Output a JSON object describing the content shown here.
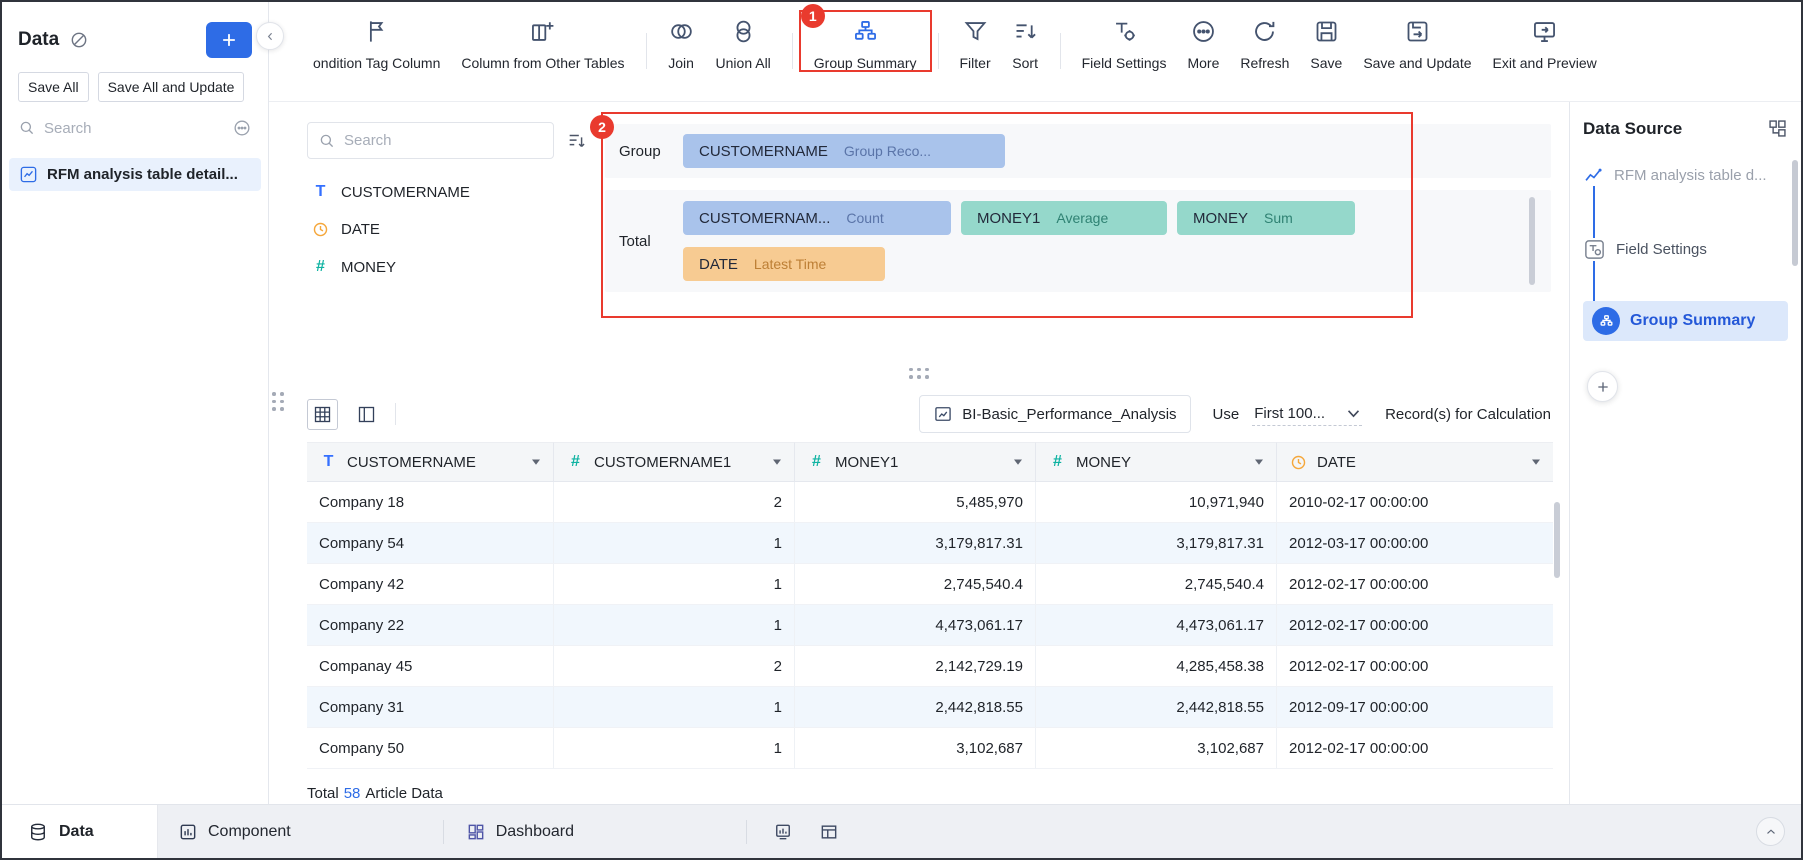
{
  "annotations": {
    "badge1": "1",
    "badge2": "2"
  },
  "left_sidebar": {
    "title": "Data",
    "save_all": "Save All",
    "save_all_update": "Save All and Update",
    "search_placeholder": "Search",
    "selected_table": "RFM analysis table detail..."
  },
  "toolbar": {
    "items": [
      {
        "label": "ondition Tag Column"
      },
      {
        "label": "Column from Other Tables"
      },
      {
        "label": "Join"
      },
      {
        "label": "Union All"
      },
      {
        "label": "Group Summary"
      },
      {
        "label": "Filter"
      },
      {
        "label": "Sort"
      },
      {
        "label": "Field Settings"
      },
      {
        "label": "More"
      },
      {
        "label": "Refresh"
      },
      {
        "label": "Save"
      },
      {
        "label": "Save and Update"
      },
      {
        "label": "Exit and Preview"
      }
    ]
  },
  "config": {
    "search_placeholder": "Search",
    "fields": [
      {
        "name": "CUSTOMERNAME",
        "icon": "text-icon"
      },
      {
        "name": "DATE",
        "icon": "date-icon"
      },
      {
        "name": "MONEY",
        "icon": "number-icon"
      }
    ],
    "group_label": "Group",
    "total_label": "Total",
    "group_chips": [
      {
        "name": "CUSTOMERNAME",
        "agg": "Group Reco...",
        "color": "blue"
      }
    ],
    "total_chips": [
      {
        "name": "CUSTOMERNAM...",
        "agg": "Count",
        "color": "blue"
      },
      {
        "name": "MONEY1",
        "agg": "Average",
        "color": "teal"
      },
      {
        "name": "MONEY",
        "agg": "Sum",
        "color": "teal"
      },
      {
        "name": "DATE",
        "agg": "Latest Time",
        "color": "orange"
      }
    ]
  },
  "table_bar": {
    "dataset": "BI-Basic_Performance_Analysis",
    "use": "Use",
    "records": "First 100...",
    "suffix": "Record(s) for Calculation"
  },
  "data_table": {
    "columns": [
      {
        "name": "CUSTOMERNAME",
        "icon": "text-icon"
      },
      {
        "name": "CUSTOMERNAME1",
        "icon": "number-icon"
      },
      {
        "name": "MONEY1",
        "icon": "number-icon"
      },
      {
        "name": "MONEY",
        "icon": "number-icon"
      },
      {
        "name": "DATE",
        "icon": "date-icon"
      }
    ],
    "rows": [
      [
        "Company 18",
        "2",
        "5,485,970",
        "10,971,940",
        "2010-02-17 00:00:00"
      ],
      [
        "Company 54",
        "1",
        "3,179,817.31",
        "3,179,817.31",
        "2012-03-17 00:00:00"
      ],
      [
        "Company 42",
        "1",
        "2,745,540.4",
        "2,745,540.4",
        "2012-02-17 00:00:00"
      ],
      [
        "Company 22",
        "1",
        "4,473,061.17",
        "4,473,061.17",
        "2012-02-17 00:00:00"
      ],
      [
        "Companay 45",
        "2",
        "2,142,729.19",
        "4,285,458.38",
        "2012-02-17 00:00:00"
      ],
      [
        "Company 31",
        "1",
        "2,442,818.55",
        "2,442,818.55",
        "2012-09-17 00:00:00"
      ],
      [
        "Company 50",
        "1",
        "3,102,687",
        "3,102,687",
        "2012-02-17 00:00:00"
      ]
    ],
    "footer": {
      "label": "Total",
      "count": "58",
      "suffix": "Article Data"
    }
  },
  "right_sidebar": {
    "title": "Data Source",
    "nodes": [
      {
        "label": "RFM analysis table d..."
      },
      {
        "label": "Field Settings"
      },
      {
        "label": "Group Summary"
      }
    ]
  },
  "bottom_bar": {
    "data": "Data",
    "component": "Component",
    "dashboard": "Dashboard"
  },
  "colors": {
    "primary_blue": "#2e6ce6",
    "annotation_red": "#e93a2e",
    "chip_blue": "#a9c3eb",
    "chip_teal": "#95d8cb",
    "chip_orange": "#f7cb92"
  }
}
